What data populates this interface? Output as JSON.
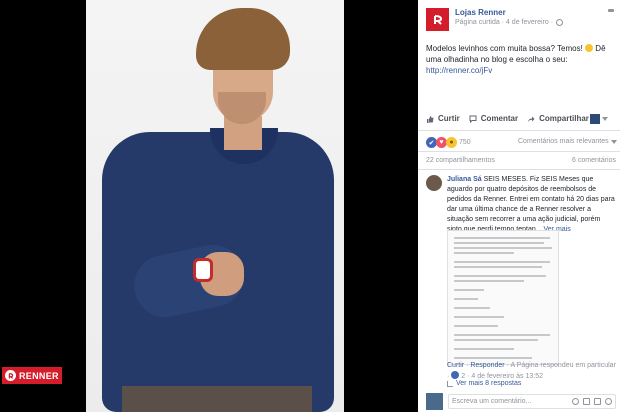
{
  "photo": {
    "brand_label": "RENNER"
  },
  "post": {
    "page_name": "Lojas Renner",
    "meta": "Página curtida · 4 de fevereiro ·",
    "text": "Modelos levinhos com muita bossa? Temos!",
    "text_after": "Dê uma olhadinha no blog e escolha o seu:",
    "link": "http://renner.co/jFv",
    "actions": {
      "like": "Curtir",
      "comment": "Comentar",
      "share": "Compartilhar"
    },
    "reactions_count": "750",
    "ranking_label": "Comentários mais relevantes",
    "shares": "22 compartilhamentos",
    "comments_count": "6 comentários"
  },
  "comment": {
    "author": "Juliana Sá",
    "text": "SEIS MESES. Fiz SEIS Meses que aguardo por quatro depósitos de reembolsos de pedidos da Renner. Entrei em contato há 20 dias para dar uma última chance de a Renner resolver a situação sem recorrer a uma ação judicial, porém sinto que perdi tempo tentan...",
    "more": "Ver mais",
    "actions": {
      "like": "Curtir",
      "reply": "Responder",
      "page_replied": "· A Página respondeu em particular ·",
      "reply_count": "2",
      "date": "· 4 de fevereiro às 13:52"
    },
    "more_replies": "Ver mais 8 respostas"
  },
  "composer": {
    "placeholder": "Escreva um comentário..."
  },
  "colors": {
    "brand_red": "#d51c2a",
    "link_blue": "#365899",
    "shirt": "#253a69"
  }
}
